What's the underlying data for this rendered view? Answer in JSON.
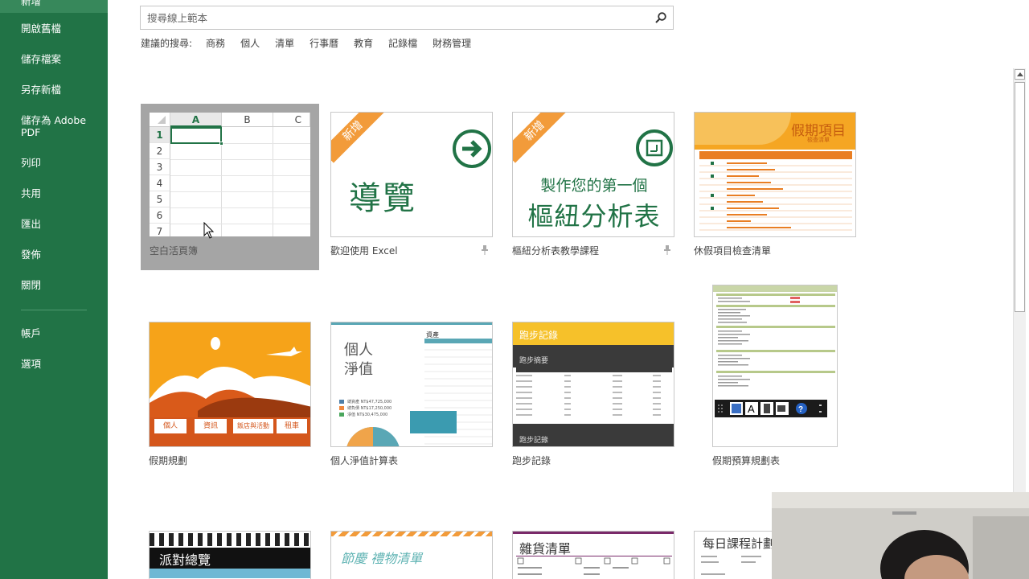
{
  "sidebar": {
    "items": [
      {
        "label": "新增"
      },
      {
        "label": "開啟舊檔"
      },
      {
        "label": "儲存檔案"
      },
      {
        "label": "另存新檔"
      },
      {
        "label": "儲存為 Adobe PDF"
      },
      {
        "label": "列印"
      },
      {
        "label": "共用"
      },
      {
        "label": "匯出"
      },
      {
        "label": "發佈"
      },
      {
        "label": "關閉"
      },
      {
        "label": "帳戶"
      },
      {
        "label": "選項"
      }
    ]
  },
  "search": {
    "placeholder": "搜尋線上範本",
    "suggested_label": "建議的搜尋:",
    "suggestions": [
      "商務",
      "個人",
      "清單",
      "行事曆",
      "教育",
      "記錄檔",
      "財務管理"
    ]
  },
  "templates": [
    {
      "label": "空白活頁簿"
    },
    {
      "label": "歡迎使用 Excel",
      "badge": "新增",
      "thumb_text": "導覽"
    },
    {
      "label": "樞紐分析表教學課程",
      "badge": "新增",
      "thumb_line1": "製作您的第一個",
      "thumb_line2": "樞紐分析表"
    },
    {
      "label": "休假項目檢查清單",
      "thumb_title": "假期項目",
      "thumb_sub": "檢查清單"
    },
    {
      "label": "假期規劃",
      "thumb_tags": [
        "個人",
        "資訊",
        "飯店與活動",
        "租車"
      ]
    },
    {
      "label": "個人淨值計算表",
      "thumb_title1": "個人",
      "thumb_title2": "淨值",
      "thumb_side": "資產",
      "legend": [
        "總資產 NT$47,725,000",
        "總負債 NT$17,250,000",
        "淨值 NT$30,475,000"
      ]
    },
    {
      "label": "跑步記錄",
      "thumb_title": "跑步記錄",
      "thumb_sub": "跑步摘要",
      "thumb_foot": "跑步記錄"
    },
    {
      "label": "假期預算規劃表"
    },
    {
      "label": "",
      "thumb_title": "派對總覽"
    },
    {
      "label": "",
      "thumb_title": "節慶 禮物清單"
    },
    {
      "label": "",
      "thumb_title": "雜貨清單"
    },
    {
      "label": "",
      "thumb_title": "每日課程計劃"
    }
  ],
  "grid": {
    "columns": [
      "A",
      "B",
      "C"
    ],
    "rows": [
      "1",
      "2",
      "3",
      "4",
      "5",
      "6",
      "7"
    ]
  },
  "colors": {
    "accent": "#217346",
    "orange": "#f29b3a"
  }
}
